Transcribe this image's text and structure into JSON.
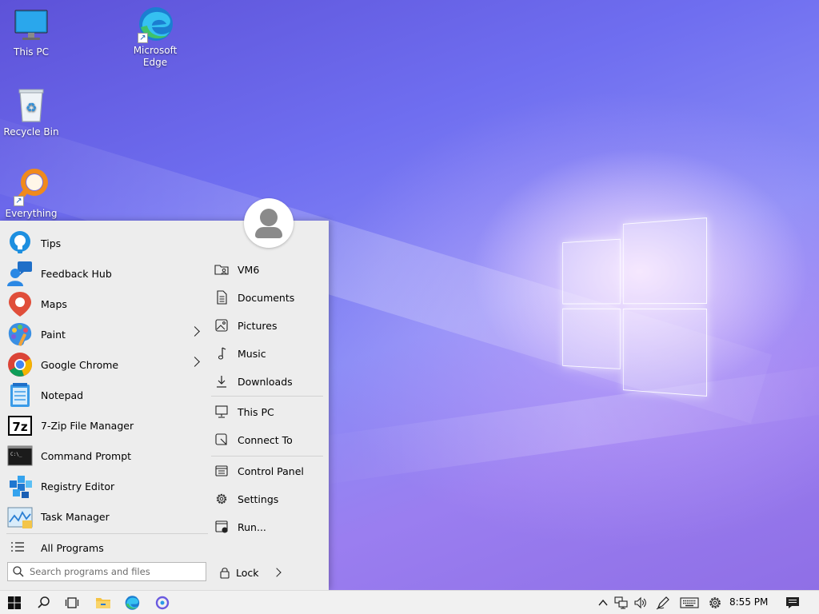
{
  "desktop": {
    "icons": [
      {
        "label": "This PC"
      },
      {
        "label": "Microsoft Edge"
      },
      {
        "label": "Recycle Bin"
      },
      {
        "label": "Everything"
      }
    ]
  },
  "start_menu": {
    "programs": [
      {
        "label": "Tips",
        "icon": "tips-icon",
        "has_submenu": false
      },
      {
        "label": "Feedback Hub",
        "icon": "feedback-hub-icon",
        "has_submenu": false
      },
      {
        "label": "Maps",
        "icon": "maps-icon",
        "has_submenu": false
      },
      {
        "label": "Paint",
        "icon": "paint-icon",
        "has_submenu": true
      },
      {
        "label": "Google Chrome",
        "icon": "chrome-icon",
        "has_submenu": true
      },
      {
        "label": "Notepad",
        "icon": "notepad-icon",
        "has_submenu": false
      },
      {
        "label": "7-Zip File Manager",
        "icon": "7zip-icon",
        "has_submenu": false
      },
      {
        "label": "Command Prompt",
        "icon": "command-prompt-icon",
        "has_submenu": false
      },
      {
        "label": "Registry Editor",
        "icon": "registry-editor-icon",
        "has_submenu": false
      },
      {
        "label": "Task Manager",
        "icon": "task-manager-icon",
        "has_submenu": false
      }
    ],
    "all_programs": "All Programs",
    "search_placeholder": "Search programs and files",
    "places": [
      {
        "label": "VM6",
        "icon": "user-folder-icon"
      },
      {
        "label": "Documents",
        "icon": "document-icon"
      },
      {
        "label": "Pictures",
        "icon": "picture-icon"
      },
      {
        "label": "Music",
        "icon": "music-note-icon"
      },
      {
        "label": "Downloads",
        "icon": "download-icon"
      },
      {
        "label": "This PC",
        "icon": "computer-icon"
      },
      {
        "label": "Connect To",
        "icon": "connect-icon"
      },
      {
        "label": "Control Panel",
        "icon": "control-panel-icon"
      },
      {
        "label": "Settings",
        "icon": "gear-icon"
      },
      {
        "label": "Run...",
        "icon": "run-icon"
      }
    ],
    "lock_label": "Lock"
  },
  "taskbar": {
    "clock": "8:55 PM"
  },
  "colors": {
    "menu_bg": "#ededed",
    "taskbar_bg": "#f1f1f1",
    "windows_blue": "#0078d4"
  }
}
